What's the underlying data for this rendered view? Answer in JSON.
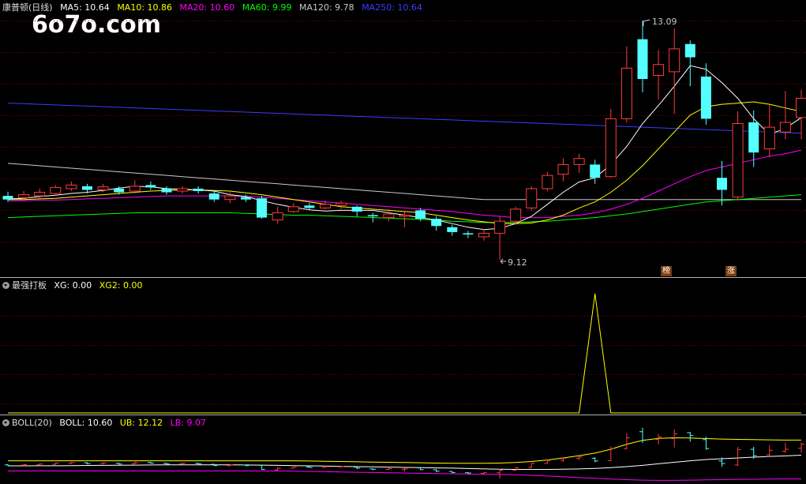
{
  "main_header": {
    "stock_name": "康普顿(日线)",
    "ma5": "MA5: 10.64",
    "ma10": "MA10: 10.86",
    "ma20": "MA20: 10.60",
    "ma60": "MA60: 9.99",
    "ma120": "MA120: 9.78",
    "ma250": "MA250: 10.64"
  },
  "watermark": "6o7o.com",
  "high_label": "13.09",
  "low_label": "9.12",
  "badges": [
    "榜",
    "涨"
  ],
  "ind_header": {
    "name": "最强打板",
    "xg": "XG: 0.00",
    "xg2": "XG2: 0.00"
  },
  "boll_header": {
    "name": "BOLL(20)",
    "boll": "BOLL: 10.60",
    "ub": "UB: 12.12",
    "lb": "LB: 9.07"
  },
  "colors": {
    "up": "#ff3c3c",
    "down": "#54ffff",
    "ma5": "#ffffff",
    "ma10": "#ffff00",
    "ma20": "#ff00ff",
    "ma60": "#00ff00",
    "ma120": "#c8c8c8",
    "ma250": "#3c3cff",
    "grid": "#8b0000"
  },
  "chart_data": {
    "type": "candlestick",
    "candles": [
      [
        10.18,
        10.12,
        10.25,
        10.08
      ],
      [
        10.15,
        10.2,
        10.26,
        10.1
      ],
      [
        10.18,
        10.24,
        10.3,
        10.14
      ],
      [
        10.22,
        10.32,
        10.36,
        10.18
      ],
      [
        10.3,
        10.36,
        10.42,
        10.26
      ],
      [
        10.34,
        10.28,
        10.38,
        10.22
      ],
      [
        10.28,
        10.33,
        10.38,
        10.24
      ],
      [
        10.3,
        10.24,
        10.34,
        10.2
      ],
      [
        10.26,
        10.34,
        10.44,
        10.22
      ],
      [
        10.36,
        10.32,
        10.42,
        10.28
      ],
      [
        10.3,
        10.24,
        10.34,
        10.2
      ],
      [
        10.26,
        10.3,
        10.34,
        10.22
      ],
      [
        10.3,
        10.26,
        10.34,
        10.22
      ],
      [
        10.22,
        10.12,
        10.26,
        10.08
      ],
      [
        10.12,
        10.18,
        10.24,
        10.06
      ],
      [
        10.16,
        10.12,
        10.2,
        10.08
      ],
      [
        10.14,
        9.82,
        10.18,
        9.8
      ],
      [
        9.78,
        9.9,
        10.0,
        9.72
      ],
      [
        9.92,
        10.0,
        10.06,
        9.9
      ],
      [
        10.02,
        9.98,
        10.06,
        9.94
      ],
      [
        9.98,
        10.04,
        10.1,
        9.96
      ],
      [
        10.02,
        10.06,
        10.1,
        9.96
      ],
      [
        10.0,
        9.92,
        10.02,
        9.84
      ],
      [
        9.86,
        9.84,
        9.9,
        9.74
      ],
      [
        9.82,
        9.88,
        9.96,
        9.76
      ],
      [
        9.84,
        9.86,
        9.92,
        9.66
      ],
      [
        9.94,
        9.8,
        9.98,
        9.76
      ],
      [
        9.8,
        9.68,
        9.84,
        9.6
      ],
      [
        9.66,
        9.58,
        9.7,
        9.52
      ],
      [
        9.56,
        9.54,
        9.6,
        9.48
      ],
      [
        9.5,
        9.56,
        9.62,
        9.44
      ],
      [
        9.56,
        9.76,
        9.84,
        9.12
      ],
      [
        9.76,
        9.96,
        10.0,
        9.7
      ],
      [
        9.98,
        10.3,
        10.34,
        9.94
      ],
      [
        10.3,
        10.52,
        10.58,
        10.26
      ],
      [
        10.54,
        10.7,
        10.8,
        10.42
      ],
      [
        10.7,
        10.8,
        10.88,
        10.56
      ],
      [
        10.7,
        10.48,
        10.78,
        10.38
      ],
      [
        10.5,
        11.46,
        11.62,
        10.48
      ],
      [
        11.46,
        12.3,
        12.66,
        11.4
      ],
      [
        12.78,
        12.12,
        13.09,
        11.9
      ],
      [
        12.18,
        12.36,
        12.6,
        11.78
      ],
      [
        12.24,
        12.62,
        12.96,
        11.54
      ],
      [
        12.7,
        12.48,
        12.76,
        12.0
      ],
      [
        12.16,
        11.46,
        12.38,
        11.36
      ],
      [
        10.48,
        10.28,
        10.76,
        10.02
      ],
      [
        10.16,
        11.38,
        11.58,
        10.1
      ],
      [
        11.4,
        10.9,
        11.6,
        10.66
      ],
      [
        10.96,
        11.32,
        11.7,
        10.82
      ],
      [
        11.24,
        11.4,
        11.92,
        11.12
      ],
      [
        11.48,
        11.8,
        11.94,
        11.12
      ]
    ],
    "ma5": [
      10.13,
      10.14,
      10.17,
      10.19,
      10.22,
      10.24,
      10.27,
      10.31,
      10.34,
      10.33,
      10.3,
      10.29,
      10.28,
      10.26,
      10.2,
      10.17,
      10.1,
      10.04,
      9.99,
      9.95,
      9.93,
      9.94,
      9.94,
      9.94,
      9.9,
      9.86,
      9.82,
      9.78,
      9.72,
      9.66,
      9.62,
      9.64,
      9.72,
      9.84,
      10.04,
      10.24,
      10.41,
      10.48,
      10.7,
      11.0,
      11.38,
      11.68,
      12.0,
      12.34,
      12.28,
      12.06,
      11.8,
      11.46,
      11.2,
      11.3,
      11.48
    ],
    "ma10": [
      10.12,
      10.12,
      10.13,
      10.14,
      10.16,
      10.18,
      10.2,
      10.22,
      10.24,
      10.26,
      10.27,
      10.28,
      10.28,
      10.27,
      10.26,
      10.23,
      10.2,
      10.16,
      10.12,
      10.08,
      10.04,
      10.0,
      9.98,
      9.96,
      9.94,
      9.92,
      9.9,
      9.86,
      9.82,
      9.78,
      9.75,
      9.72,
      9.72,
      9.73,
      9.78,
      9.86,
      9.98,
      10.08,
      10.24,
      10.44,
      10.68,
      10.96,
      11.24,
      11.52,
      11.66,
      11.7,
      11.72,
      11.74,
      11.7,
      11.64,
      11.58
    ],
    "ma20": [
      10.1,
      10.1,
      10.11,
      10.11,
      10.12,
      10.13,
      10.14,
      10.15,
      10.16,
      10.17,
      10.18,
      10.18,
      10.18,
      10.18,
      10.18,
      10.17,
      10.16,
      10.14,
      10.12,
      10.1,
      10.08,
      10.06,
      10.04,
      10.02,
      10.0,
      9.98,
      9.96,
      9.94,
      9.92,
      9.89,
      9.86,
      9.84,
      9.82,
      9.82,
      9.82,
      9.84,
      9.86,
      9.9,
      9.96,
      10.04,
      10.14,
      10.26,
      10.38,
      10.5,
      10.6,
      10.66,
      10.72,
      10.78,
      10.84,
      10.88,
      10.94
    ],
    "ma60": [
      9.82,
      9.83,
      9.84,
      9.85,
      9.86,
      9.87,
      9.88,
      9.89,
      9.9,
      9.9,
      9.9,
      9.9,
      9.9,
      9.9,
      9.9,
      9.89,
      9.88,
      9.87,
      9.86,
      9.86,
      9.85,
      9.84,
      9.83,
      9.82,
      9.81,
      9.8,
      9.79,
      9.78,
      9.76,
      9.75,
      9.74,
      9.74,
      9.74,
      9.75,
      9.76,
      9.78,
      9.8,
      9.82,
      9.85,
      9.88,
      9.92,
      9.96,
      10.0,
      10.04,
      10.08,
      10.1,
      10.12,
      10.14,
      10.16,
      10.18,
      10.2
    ],
    "ma120": [
      10.72,
      10.7,
      10.68,
      10.66,
      10.64,
      10.62,
      10.6,
      10.58,
      10.56,
      10.54,
      10.52,
      10.5,
      10.48,
      10.46,
      10.44,
      10.42,
      10.4,
      10.38,
      10.36,
      10.34,
      10.32,
      10.3,
      10.28,
      10.26,
      10.24,
      10.22,
      10.2,
      10.18,
      10.16,
      10.14,
      10.12,
      10.12,
      10.12,
      10.12,
      10.12,
      10.12,
      10.12,
      10.12,
      10.12,
      10.12,
      10.12,
      10.12,
      10.12,
      10.12,
      10.12,
      10.12,
      10.12,
      10.12,
      10.12,
      10.12,
      10.12
    ],
    "ma250": [
      11.72,
      11.71,
      11.7,
      11.69,
      11.68,
      11.67,
      11.66,
      11.65,
      11.64,
      11.63,
      11.62,
      11.61,
      11.6,
      11.59,
      11.58,
      11.57,
      11.56,
      11.55,
      11.54,
      11.53,
      11.52,
      11.51,
      11.5,
      11.49,
      11.48,
      11.47,
      11.46,
      11.45,
      11.44,
      11.43,
      11.42,
      11.41,
      11.4,
      11.39,
      11.38,
      11.37,
      11.36,
      11.35,
      11.34,
      11.33,
      11.32,
      11.31,
      11.3,
      11.29,
      11.28,
      11.27,
      11.26,
      11.25,
      11.24,
      11.23,
      11.22
    ],
    "xg": [
      0,
      0,
      0,
      0,
      0,
      0,
      0,
      0,
      0,
      0,
      0,
      0,
      0,
      0,
      0,
      0,
      0,
      0,
      0,
      0,
      0,
      0,
      0,
      0,
      0,
      0,
      0,
      0,
      0,
      0,
      0,
      0,
      0,
      0,
      0,
      0,
      0,
      1,
      0,
      0,
      0,
      0,
      0,
      0,
      0,
      0,
      0,
      0,
      0,
      0,
      0
    ],
    "boll_ub": [
      10.5,
      10.5,
      10.5,
      10.5,
      10.5,
      10.5,
      10.5,
      10.5,
      10.5,
      10.5,
      10.5,
      10.5,
      10.5,
      10.5,
      10.5,
      10.5,
      10.5,
      10.5,
      10.5,
      10.48,
      10.46,
      10.44,
      10.42,
      10.4,
      10.38,
      10.36,
      10.34,
      10.32,
      10.3,
      10.3,
      10.3,
      10.32,
      10.36,
      10.44,
      10.56,
      10.72,
      10.9,
      11.1,
      11.4,
      11.8,
      12.1,
      12.26,
      12.3,
      12.28,
      12.24,
      12.2,
      12.18,
      12.16,
      12.14,
      12.12,
      12.12
    ],
    "boll_lb": [
      9.7,
      9.7,
      9.7,
      9.7,
      9.7,
      9.7,
      9.7,
      9.7,
      9.7,
      9.7,
      9.7,
      9.7,
      9.7,
      9.7,
      9.7,
      9.7,
      9.7,
      9.7,
      9.68,
      9.66,
      9.64,
      9.62,
      9.6,
      9.58,
      9.56,
      9.54,
      9.52,
      9.5,
      9.48,
      9.46,
      9.44,
      9.42,
      9.4,
      9.36,
      9.3,
      9.24,
      9.18,
      9.12,
      9.06,
      9.02,
      8.98,
      8.96,
      8.96,
      8.98,
      9.0,
      9.02,
      9.04,
      9.05,
      9.06,
      9.07,
      9.07
    ]
  }
}
